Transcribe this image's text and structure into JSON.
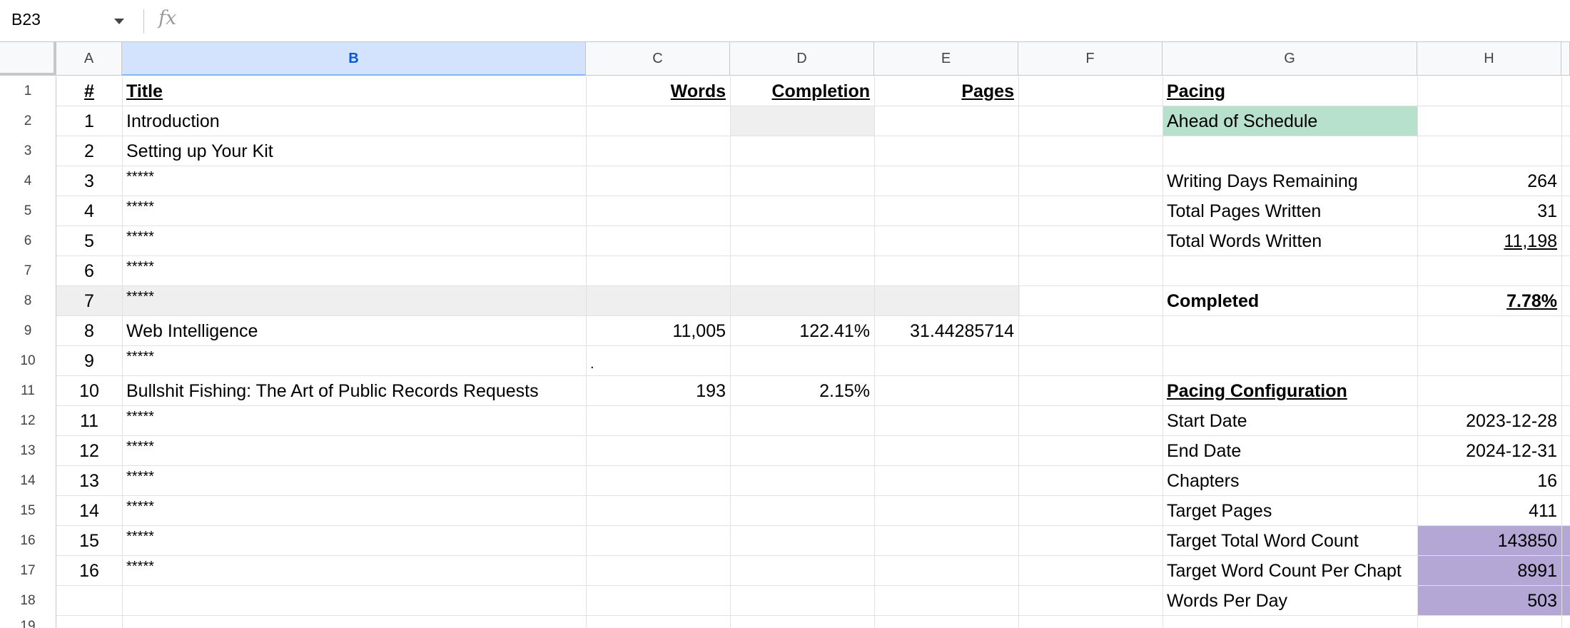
{
  "formula_bar": {
    "name_box": "B23",
    "fx_label": "fx"
  },
  "columns": [
    "A",
    "B",
    "C",
    "D",
    "E",
    "F",
    "G",
    "H"
  ],
  "rows": [
    "1",
    "2",
    "3",
    "4",
    "5",
    "6",
    "7",
    "8",
    "9",
    "10",
    "11",
    "12",
    "13",
    "14",
    "15",
    "16",
    "17",
    "18",
    "19"
  ],
  "headers": {
    "num": "#",
    "title": "Title",
    "words": "Words",
    "completion": "Completion",
    "pages": "Pages"
  },
  "chapters": [
    {
      "num": "1",
      "title": "Introduction",
      "words": "",
      "completion": "",
      "pages": ""
    },
    {
      "num": "2",
      "title": "Setting up Your Kit",
      "words": "",
      "completion": "",
      "pages": ""
    },
    {
      "num": "3",
      "title": "*****",
      "words": "",
      "completion": "",
      "pages": ""
    },
    {
      "num": "4",
      "title": "*****",
      "words": "",
      "completion": "",
      "pages": ""
    },
    {
      "num": "5",
      "title": "*****",
      "words": "",
      "completion": "",
      "pages": ""
    },
    {
      "num": "6",
      "title": "*****",
      "words": "",
      "completion": "",
      "pages": ""
    },
    {
      "num": "7",
      "title": "*****",
      "words": "",
      "completion": "",
      "pages": ""
    },
    {
      "num": "8",
      "title": "Web Intelligence",
      "words": "11,005",
      "completion": "122.41%",
      "pages": "31.44285714"
    },
    {
      "num": "9",
      "title": "*****",
      "words": ".",
      "completion": "",
      "pages": ""
    },
    {
      "num": "10",
      "title": "Bullshit Fishing: The Art of Public Records Requests",
      "words": "193",
      "completion": "2.15%",
      "pages": ""
    },
    {
      "num": "11",
      "title": "*****",
      "words": "",
      "completion": "",
      "pages": ""
    },
    {
      "num": "12",
      "title": "*****",
      "words": "",
      "completion": "",
      "pages": ""
    },
    {
      "num": "13",
      "title": "*****",
      "words": "",
      "completion": "",
      "pages": ""
    },
    {
      "num": "14",
      "title": "*****",
      "words": "",
      "completion": "",
      "pages": ""
    },
    {
      "num": "15",
      "title": "*****",
      "words": "",
      "completion": "",
      "pages": ""
    },
    {
      "num": "16",
      "title": "*****",
      "words": "",
      "completion": "",
      "pages": ""
    }
  ],
  "pacing": {
    "heading": "Pacing",
    "status": "Ahead of Schedule",
    "writing_days_label": "Writing Days Remaining",
    "writing_days_value": "264",
    "total_pages_label": "Total Pages Written",
    "total_pages_value": "31",
    "total_words_label": "Total Words Written",
    "total_words_value": "11,198",
    "completed_label": "Completed",
    "completed_value": "7.78%"
  },
  "config": {
    "heading": "Pacing Configuration",
    "start_date_label": "Start Date",
    "start_date_value": "2023-12-28",
    "end_date_label": "End Date",
    "end_date_value": "2024-12-31",
    "chapters_label": "Chapters",
    "chapters_value": "16",
    "target_pages_label": "Target Pages",
    "target_pages_value": "411",
    "target_total_words_label": "Target Total Word Count",
    "target_total_words_value": "143850",
    "target_words_per_chapter_label": "Target Word Count Per Chapt",
    "target_words_per_chapter_value": "8991",
    "words_per_day_label": "Words Per Day",
    "words_per_day_value": "503"
  },
  "colors": {
    "selected_column": "#d3e3fd",
    "status_green": "#b7e1cd",
    "highlight_purple": "#b4a7d6",
    "gray_fill": "#efefef"
  }
}
